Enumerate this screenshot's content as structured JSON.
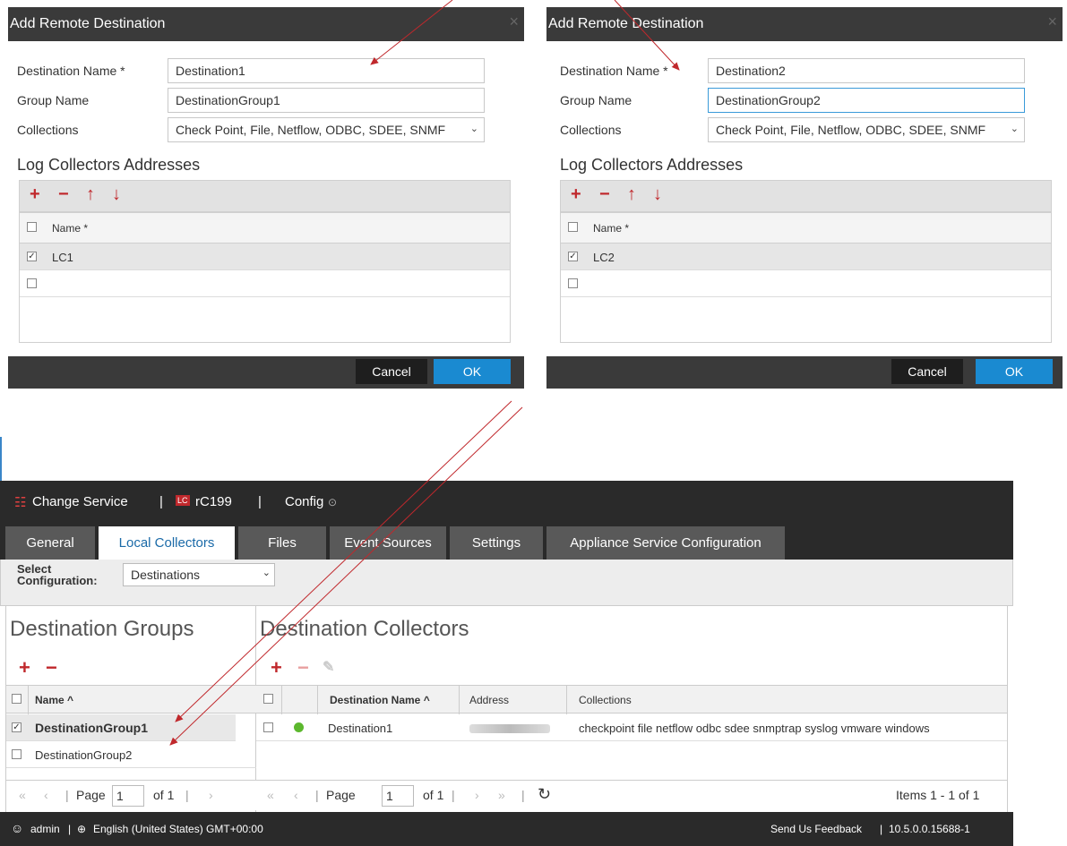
{
  "dialogs": [
    {
      "title": "Add Remote Destination",
      "close_glyph": "×",
      "fields": {
        "destination_name_label": "Destination Name *",
        "destination_name_value": "Destination1",
        "group_name_label": "Group Name",
        "group_name_value": "DestinationGroup1",
        "collections_label": "Collections",
        "collections_value": "Check Point, File, Netflow, ODBC, SDEE, SNMF"
      },
      "section_title": "Log Collectors Addresses",
      "grid_header": "Name *",
      "rows": [
        "LC1",
        ""
      ],
      "cancel_label": "Cancel",
      "ok_label": "OK"
    },
    {
      "title": "Add Remote Destination",
      "close_glyph": "×",
      "fields": {
        "destination_name_label": "Destination Name *",
        "destination_name_value": "Destination2",
        "group_name_label": "Group Name",
        "group_name_value": "DestinationGroup2",
        "collections_label": "Collections",
        "collections_value": "Check Point, File, Netflow, ODBC, SDEE, SNMF"
      },
      "section_title": "Log Collectors Addresses",
      "grid_header": "Name *",
      "rows": [
        "LC2",
        ""
      ],
      "cancel_label": "Cancel",
      "ok_label": "OK"
    }
  ],
  "app": {
    "topbar": {
      "change_service": "Change Service",
      "sep1": "|",
      "service_badge": "LC",
      "service_name": "rC199",
      "sep2": "|",
      "config": "Config"
    },
    "tabs": [
      "General",
      "Local Collectors",
      "Files",
      "Event Sources",
      "Settings",
      "Appliance Service Configuration"
    ],
    "active_tab": "Local Collectors",
    "select_configuration_label_1": "Select",
    "select_configuration_label_2": "Configuration:",
    "select_configuration_value": "Destinations",
    "groups_panel": {
      "title": "Destination Groups",
      "header_name": "Name ^",
      "rows": [
        "DestinationGroup1",
        "DestinationGroup2"
      ],
      "pager": {
        "page_label": "Page",
        "page_value": "1",
        "of_label": "of 1"
      }
    },
    "collectors_panel": {
      "title": "Destination Collectors",
      "headers": {
        "destination_name": "Destination Name ^",
        "address": "Address",
        "collections": "Collections"
      },
      "rows": [
        {
          "destination_name": "Destination1",
          "collections": "checkpoint file netflow odbc sdee snmptrap syslog vmware windows"
        }
      ],
      "pager": {
        "page_label": "Page",
        "page_value": "1",
        "of_label": "of 1",
        "items": "Items 1 - 1 of 1"
      }
    },
    "footer": {
      "user": "admin",
      "locale": "English (United States) GMT+00:00",
      "feedback": "Send Us Feedback",
      "version": "10.5.0.0.15688-1"
    }
  },
  "colors": {
    "accent_red": "#c0282c",
    "primary_blue": "#1a8ad1",
    "dark_bar": "#2a2a2a",
    "status_green": "#5cb82e"
  }
}
